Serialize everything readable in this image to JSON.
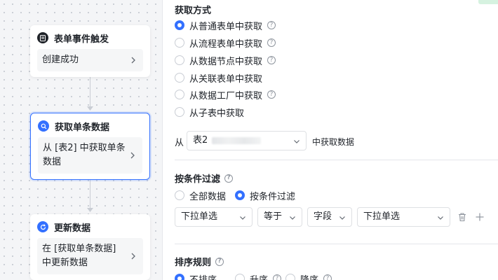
{
  "canvas": {
    "nodes": [
      {
        "title": "表单事件触发",
        "body": "创建成功",
        "icon": "document-icon",
        "icon_color": "#1f2329"
      },
      {
        "title": "获取单条数据",
        "body": "从 [表2] 中获取单条数据",
        "icon": "search-icon",
        "icon_color": "#3370ff"
      },
      {
        "title": "更新数据",
        "body": "在 [获取单条数据] 中更新数据",
        "icon": "refresh-icon",
        "icon_color": "#3370ff"
      }
    ]
  },
  "panel": {
    "source": {
      "title": "获取方式",
      "options": [
        {
          "label": "从普通表单中获取",
          "checked": true,
          "help": true
        },
        {
          "label": "从流程表单中获取",
          "checked": false,
          "help": true
        },
        {
          "label": "从数据节点中获取",
          "checked": false,
          "help": true
        },
        {
          "label": "从关联表单中获取",
          "checked": false,
          "help": false
        },
        {
          "label": "从数据工厂中获取",
          "checked": false,
          "help": true
        },
        {
          "label": "从子表中获取",
          "checked": false,
          "help": false
        }
      ],
      "from_label": "从",
      "table_select": "表2",
      "suffix": "中获取数据"
    },
    "filter": {
      "title": "按条件过滤",
      "options": [
        {
          "label": "全部数据",
          "checked": false
        },
        {
          "label": "按条件过滤",
          "checked": true
        }
      ],
      "field_select": "下拉单选",
      "operator_select": "等于",
      "type_select": "字段",
      "value_select": "下拉单选"
    },
    "sort": {
      "title": "排序规则",
      "options": [
        {
          "label": "不排序",
          "checked": true,
          "help": false
        },
        {
          "label": "升序",
          "checked": false,
          "help": true
        },
        {
          "label": "降序",
          "checked": false,
          "help": true
        }
      ]
    },
    "colors": {
      "accent": "#3370ff",
      "border": "#dee0e3",
      "text": "#1f2329"
    }
  }
}
